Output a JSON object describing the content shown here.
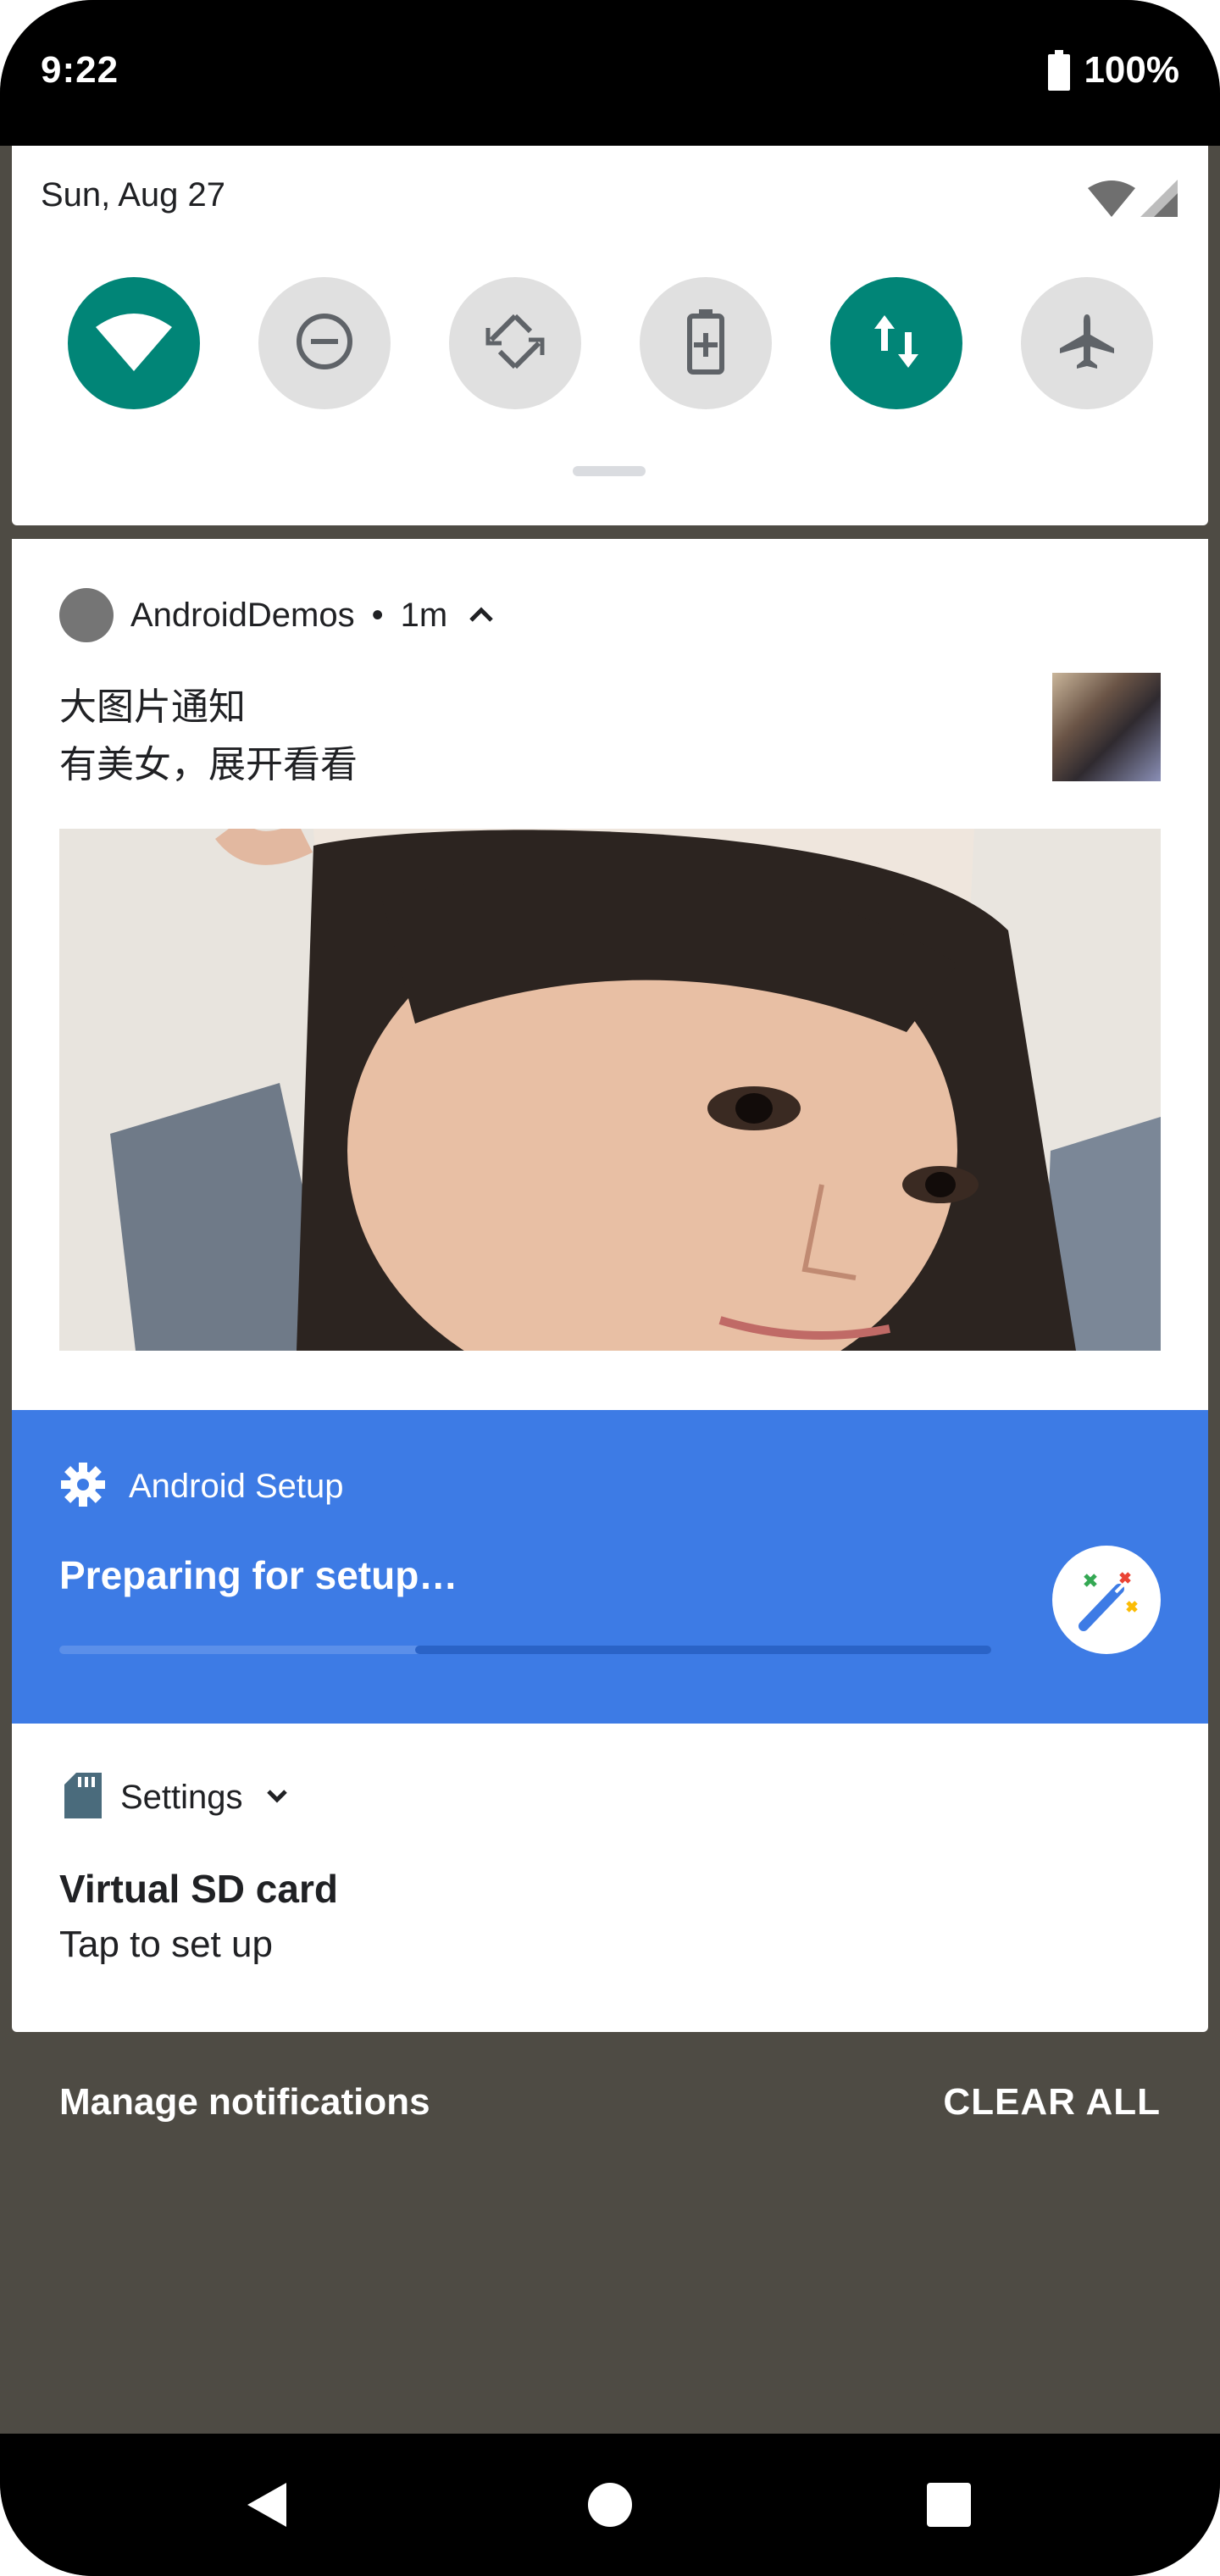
{
  "status_bar": {
    "time": "9:22",
    "battery": "100%"
  },
  "quick_settings": {
    "date": "Sun, Aug 27",
    "tiles": [
      {
        "name": "wifi-icon",
        "active": true
      },
      {
        "name": "do-not-disturb-icon",
        "active": false
      },
      {
        "name": "auto-rotate-icon",
        "active": false
      },
      {
        "name": "battery-saver-icon",
        "active": false
      },
      {
        "name": "mobile-data-icon",
        "active": true
      },
      {
        "name": "airplane-mode-icon",
        "active": false
      }
    ],
    "accent": "#018577"
  },
  "notifications": {
    "big_picture": {
      "app": "AndroidDemos",
      "separator": "•",
      "time": "1m",
      "title": "大图片通知",
      "text": "有美女，展开看看"
    },
    "setup": {
      "app": "Android Setup",
      "title": "Preparing for setup…",
      "color": "#3d7be5"
    },
    "sd_card": {
      "app": "Settings",
      "title": "Virtual SD card",
      "text": "Tap to set up"
    }
  },
  "footer": {
    "manage": "Manage notifications",
    "clear_all": "CLEAR ALL"
  },
  "nav": {
    "back": "back-icon",
    "home": "home-icon",
    "recents": "recents-icon"
  }
}
